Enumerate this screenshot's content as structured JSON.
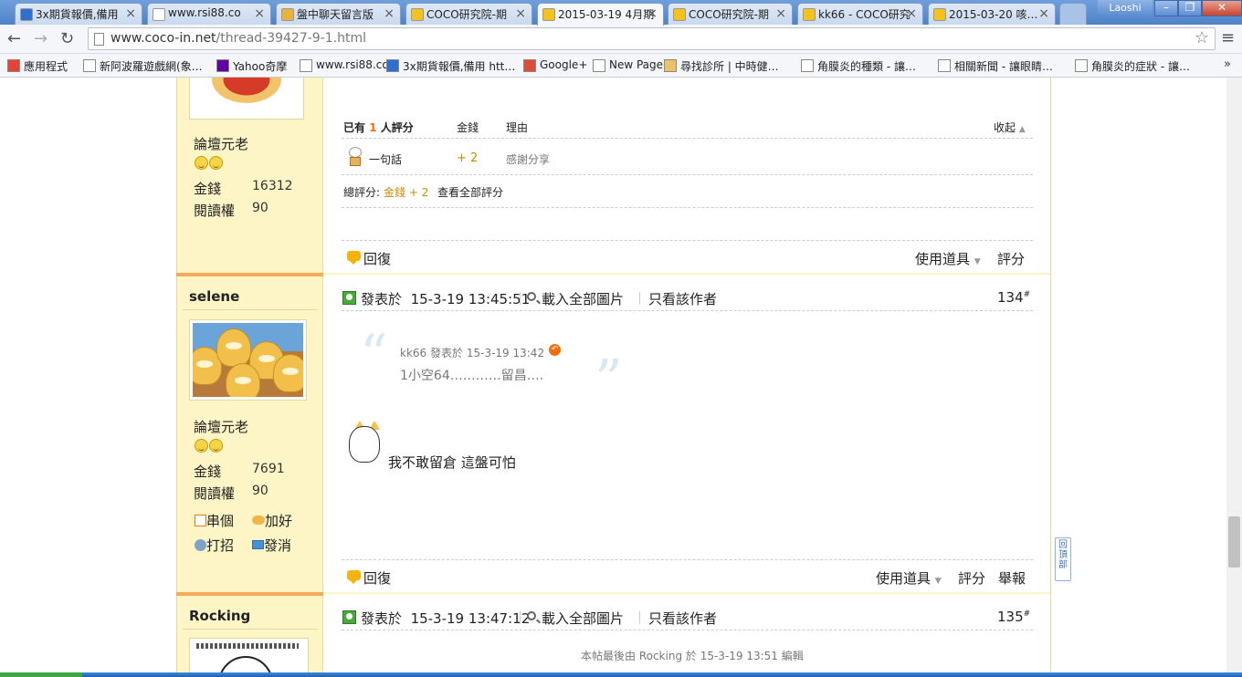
{
  "browser": {
    "tabs": [
      {
        "label": "3x期貨報價,備用",
        "fav": "#2f6fcf",
        "active": false
      },
      {
        "label": "www.rsi88.co",
        "fav": "#ffffff",
        "active": false
      },
      {
        "label": "盤中聊天留言版",
        "fav": "#e9b23a",
        "active": false
      },
      {
        "label": "COCO研究院-期",
        "fav": "#f3c21b",
        "active": false
      },
      {
        "label": "2015-03-19 4月期",
        "fav": "#f3c21b",
        "active": true
      },
      {
        "label": "COCO研究院-期",
        "fav": "#f3c21b",
        "active": false
      },
      {
        "label": "kk66 - COCO研究",
        "fav": "#f3c21b",
        "active": false
      },
      {
        "label": "2015-03-20 咳…",
        "fav": "#f3c21b",
        "active": false
      }
    ],
    "window_user": "Laoshi",
    "url_host": "www.coco-in.net",
    "url_path": "/thread-39427-9-1.html",
    "bookmarks": [
      {
        "label": "應用程式"
      },
      {
        "label": "新阿波羅遊戲網(象…"
      },
      {
        "label": "Yahoo奇摩"
      },
      {
        "label": "www.rsi88.co"
      },
      {
        "label": "3x期貨報價,備用 htt…"
      },
      {
        "label": "Google+"
      },
      {
        "label": "New Page"
      },
      {
        "label": "尋找診所 | 中時健…"
      },
      {
        "label": "角膜炎的種類 - 讓…"
      },
      {
        "label": "相關新聞 - 讓眼睛…"
      },
      {
        "label": "角膜炎的症狀 - 讓…"
      }
    ],
    "bookmarks_more": "»"
  },
  "post1": {
    "user_title": "論壇元老",
    "money_label": "金錢",
    "money": "16312",
    "read_label": "閱讀權",
    "read": "90",
    "rating": {
      "head_prefix": "已有",
      "head_count": "1",
      "head_suffix": "人評分",
      "col_money": "金錢",
      "col_reason": "理由",
      "collapse": "收起",
      "rater": "一句話",
      "amount": "+ 2",
      "reason": "感謝分享",
      "total_label": "總評分:",
      "total_value": "金錢 + 2",
      "view_all": "查看全部評分"
    },
    "reply": "回復",
    "tools": "使用道具",
    "rate": "評分"
  },
  "post2": {
    "username": "selene",
    "user_title": "論壇元老",
    "money_label": "金錢",
    "money": "7691",
    "read_label": "閱讀權",
    "read": "90",
    "actions": {
      "profile": "串個",
      "add_friend": "加好",
      "greet": "打招",
      "message": "發消"
    },
    "posted_label": "發表於",
    "posted_at": "15-3-19 13:45:51",
    "load_images": "載入全部圖片",
    "author_only": "只看該作者",
    "floor": "134",
    "floor_mark": "#",
    "quote": {
      "author": "kk66",
      "posted_label": "發表於",
      "time": "15-3-19 13:42",
      "text": "1小空64…………留昌…."
    },
    "message": "我不敢留倉  這盤可怕",
    "reply": "回復",
    "tools": "使用道具",
    "rate": "評分",
    "report": "舉報"
  },
  "post3": {
    "username": "Rocking",
    "posted_label": "發表於",
    "posted_at": "15-3-19 13:47:12",
    "load_images": "載入全部圖片",
    "author_only": "只看該作者",
    "floor": "135",
    "floor_mark": "#",
    "edit_note": "本帖最後由 Rocking 於 15-3-19 13:51 編輯"
  },
  "back_to_top": "回頂部"
}
